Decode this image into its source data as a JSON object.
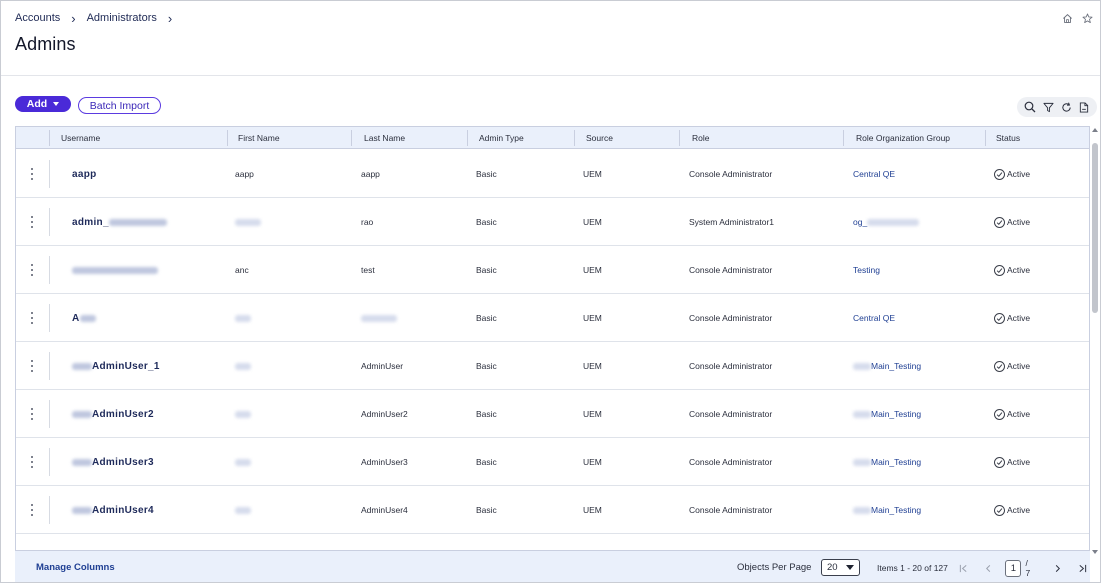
{
  "breadcrumb": [
    "Accounts",
    "Administrators"
  ],
  "page_title": "Admins",
  "actions": {
    "add_label": "Add",
    "batch_import_label": "Batch Import"
  },
  "toolbar_icons": [
    "search-icon",
    "filter-icon",
    "refresh-icon",
    "export-icon"
  ],
  "columns": [
    "Username",
    "First Name",
    "Last Name",
    "Admin Type",
    "Source",
    "Role",
    "Role Organization Group",
    "Status"
  ],
  "rows": [
    {
      "username": "aapp",
      "first_name": "aapp",
      "last_name": "aapp",
      "admin_type": "Basic",
      "source": "UEM",
      "role": "Console Administrator",
      "org_group": "Central QE",
      "status": "Active"
    },
    {
      "username": "admin_",
      "first_name": "",
      "last_name": "rao",
      "admin_type": "Basic",
      "source": "UEM",
      "role": "System Administrator1",
      "org_group": "og_",
      "status": "Active"
    },
    {
      "username": "",
      "first_name": "anc",
      "last_name": "test",
      "admin_type": "Basic",
      "source": "UEM",
      "role": "Console Administrator",
      "org_group": "Testing",
      "status": "Active"
    },
    {
      "username": "A",
      "first_name": "",
      "last_name": "",
      "admin_type": "Basic",
      "source": "UEM",
      "role": "Console Administrator",
      "org_group": "Central QE",
      "status": "Active"
    },
    {
      "username": "AdminUser_1",
      "first_name": "",
      "last_name": "AdminUser",
      "admin_type": "Basic",
      "source": "UEM",
      "role": "Console Administrator",
      "org_group": "Main_Testing",
      "status": "Active"
    },
    {
      "username": "AdminUser2",
      "first_name": "",
      "last_name": "AdminUser2",
      "admin_type": "Basic",
      "source": "UEM",
      "role": "Console Administrator",
      "org_group": "Main_Testing",
      "status": "Active"
    },
    {
      "username": "AdminUser3",
      "first_name": "",
      "last_name": "AdminUser3",
      "admin_type": "Basic",
      "source": "UEM",
      "role": "Console Administrator",
      "org_group": "Main_Testing",
      "status": "Active"
    },
    {
      "username": "AdminUser4",
      "first_name": "",
      "last_name": "AdminUser4",
      "admin_type": "Basic",
      "source": "UEM",
      "role": "Console Administrator",
      "org_group": "Main_Testing",
      "status": "Active"
    }
  ],
  "footer": {
    "manage_columns_label": "Manage Columns",
    "objects_per_page_label": "Objects Per Page",
    "objects_per_page_value": "20",
    "items_label": "Items 1 - 20 of 127",
    "current_page": "1",
    "total_pages": "/ 7"
  },
  "colors": {
    "primary": "#4a2ad8",
    "link": "#1f3f93",
    "header_bg": "#eaf0fb"
  }
}
